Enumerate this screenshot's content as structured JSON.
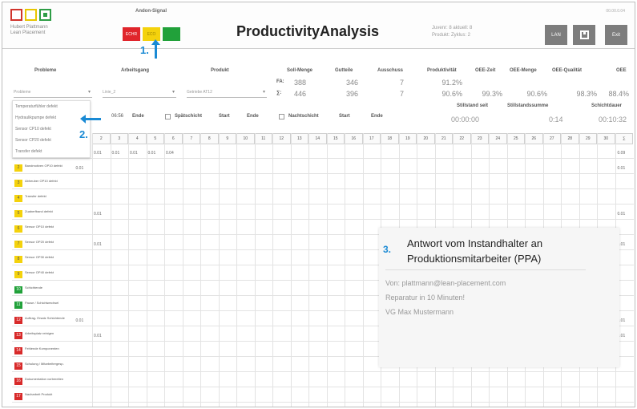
{
  "header": {
    "company": [
      "Hubert Plattmann",
      "Lean Placement"
    ],
    "andon_title": "Andon-Signal",
    "andon_red": "ECHR",
    "andon_yellow": "ECO",
    "app_title": "ProductivityAnalysis",
    "info_line1": "Juvenr: 8  aktuell: 8",
    "info_line2": "Produkt: Zyklus: 2",
    "date": "00.00.0.04",
    "lan_label": "LAN",
    "exit_label": "Exit",
    "annotation1": "1."
  },
  "controls": {
    "probleme_label": "Probleme",
    "arbeitsgang_label": "Arbeitsgang",
    "produkt_label": "Produkt",
    "probleme_value": "Probleme",
    "arbeitsgang_value": "Linie_2",
    "produkt_value": "Getriebe AT12",
    "soll_label": "Soll-Menge",
    "gutteile_label": "Gutteile",
    "ausschuss_label": "Ausschuss",
    "produktivitaet_label": "Produktivität",
    "oee_zeit_label": "OEE-Zeit",
    "oee_menge_label": "OEE-Menge",
    "oee_qualitaet_label": "OEE-Qualität",
    "oee_label": "OEE",
    "fa_label": "FA:",
    "d_label": "∑:",
    "fa_soll": "388",
    "fa_gut": "346",
    "fa_aus": "7",
    "fa_prod": "91.2%",
    "d_soll": "446",
    "d_gut": "396",
    "d_aus": "7",
    "d_prod": "90.6%",
    "d_oee_zeit": "99.3%",
    "d_oee_menge": "90.6%",
    "d_oee_qual": "98.3%",
    "d_oee": "88.4%",
    "stillstand_seit_label": "Stillstand seit",
    "stillstandsumme_label": "Stillstandssumme",
    "schichtdauer_label": "Schichtdauer",
    "stillstand_seit": "00:00:00",
    "stillstandsumme": "0:14",
    "schichtdauer": "00:10:32",
    "time_start": "06:56",
    "ende_label": "Ende",
    "spaet_label": "Spätschicht",
    "start_label": "Start",
    "nacht_label": "Nachtschicht",
    "annotation2": "2."
  },
  "dropdown": [
    "Temperaturfühler defekt",
    "Hydraulikpumpe defekt",
    "Sensor CP10 defekt",
    "Sensor CP20 defekt",
    "Transfer defekt"
  ],
  "grid": {
    "columns": [
      "2",
      "3",
      "4",
      "5",
      "6",
      "7",
      "8",
      "9",
      "10",
      "11",
      "12",
      "13",
      "14",
      "15",
      "16",
      "17",
      "18",
      "19",
      "20",
      "21",
      "22",
      "23",
      "24",
      "25",
      "26",
      "27",
      "28",
      "29",
      "30",
      "∑"
    ],
    "rows": [
      {
        "badge": "1",
        "color": "yellow",
        "label": "Tastkreisen OP10 defekt",
        "values": [
          "0.01",
          "0.01",
          "0.01",
          "0.01",
          "0.01",
          "0.04"
        ],
        "sum": "0.09"
      },
      {
        "badge": "2",
        "color": "yellow",
        "label": "Bandmotiven OP10 defekt",
        "values": [
          "0.01"
        ],
        "sum": "0.01"
      },
      {
        "badge": "3",
        "color": "yellow",
        "label": "Abheuber OP10 defekt",
        "values": [],
        "sum": ""
      },
      {
        "badge": "4",
        "color": "yellow",
        "label": "Transfer defekt",
        "values": [],
        "sum": ""
      },
      {
        "badge": "5",
        "color": "yellow",
        "label": "Zuaberfband defekt",
        "values": [
          "",
          "0.01"
        ],
        "sum": "0.01"
      },
      {
        "badge": "6",
        "color": "yellow",
        "label": "Sensor OP10 defekt",
        "values": [],
        "sum": ""
      },
      {
        "badge": "7",
        "color": "yellow",
        "label": "Sensor OP20 defekt",
        "values": [
          "",
          "0.01"
        ],
        "sum": "0.01"
      },
      {
        "badge": "8",
        "color": "yellow",
        "label": "Sensor OP30 defekt",
        "values": [],
        "sum": ""
      },
      {
        "badge": "9",
        "color": "yellow",
        "label": "Sensor OP40 defekt",
        "values": [],
        "sum": ""
      },
      {
        "badge": "10",
        "color": "green",
        "label": "Schichtende",
        "values": [],
        "sum": ""
      },
      {
        "badge": "11",
        "color": "green",
        "label": "Pause / Schichtwechsel",
        "values": [],
        "sum": ""
      },
      {
        "badge": "12",
        "color": "red",
        "label": "Auftrag- Ersatz Schichtende",
        "values": [
          "0.01"
        ],
        "sum": "0.01"
      },
      {
        "badge": "13",
        "color": "red",
        "label": "Arbeitsplatz reinigen",
        "values": [
          "",
          "0.01"
        ],
        "sum": "0.01"
      },
      {
        "badge": "14",
        "color": "red",
        "label": "Fehlende Komponenten",
        "values": [],
        "sum": ""
      },
      {
        "badge": "15",
        "color": "red",
        "label": "Schulung / Mitarbeitergesp.",
        "values": [],
        "sum": ""
      },
      {
        "badge": "16",
        "color": "red",
        "label": "Dokumentation vorbereiten",
        "values": [],
        "sum": ""
      },
      {
        "badge": "17",
        "color": "red",
        "label": "Nacharbeit Produkt",
        "values": [],
        "sum": ""
      }
    ]
  },
  "message": {
    "number": "3.",
    "title_line1": "Antwort vom Instandhalter an",
    "title_line2": "Produktionsmitarbeiter (PPA)",
    "body_line1": "Von: plattmann@lean-placement.com",
    "body_line2": "Reparatur in 10 Minuten!",
    "body_line3": "VG Max Mustermann"
  },
  "colors": {
    "accent_blue": "#1a8ad4",
    "andon_red": "#e0252b",
    "andon_yellow": "#f4d20c",
    "andon_green": "#21a13a"
  }
}
